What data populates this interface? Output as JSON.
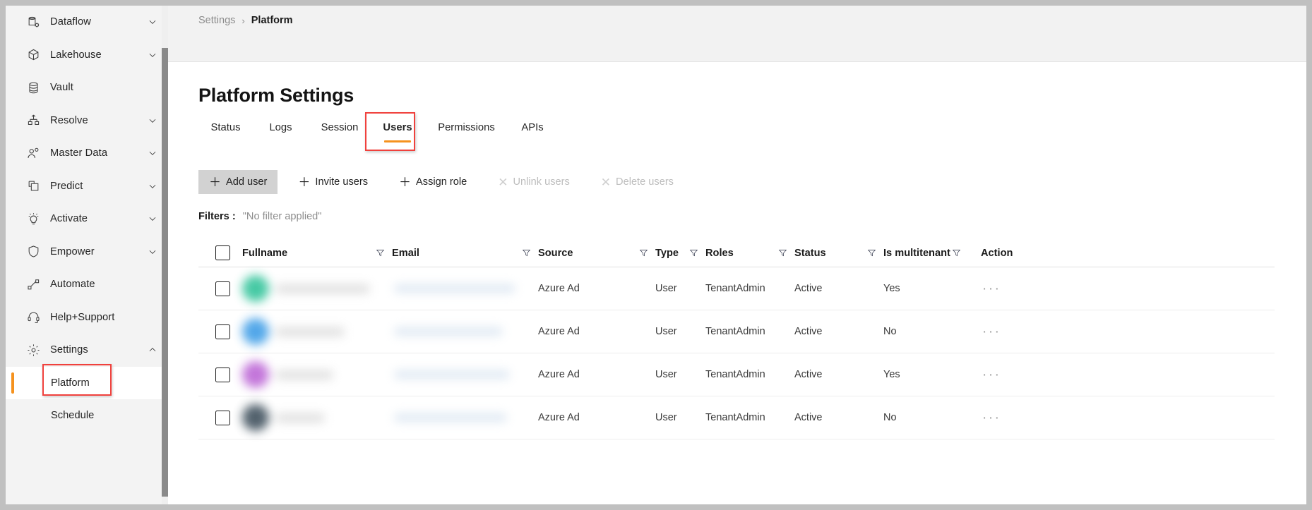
{
  "sidebar": {
    "items": [
      {
        "label": "Dataflow",
        "icon": "database-gear-icon",
        "expandable": true,
        "chevron": "down"
      },
      {
        "label": "Lakehouse",
        "icon": "cube-icon",
        "expandable": true,
        "chevron": "down"
      },
      {
        "label": "Vault",
        "icon": "database-stack-icon",
        "expandable": false,
        "chevron": ""
      },
      {
        "label": "Resolve",
        "icon": "hierarchy-up-icon",
        "expandable": true,
        "chevron": "down"
      },
      {
        "label": "Master Data",
        "icon": "person-add-icon",
        "expandable": true,
        "chevron": "down"
      },
      {
        "label": "Predict",
        "icon": "copy-squares-icon",
        "expandable": true,
        "chevron": "down"
      },
      {
        "label": "Activate",
        "icon": "lightbulb-icon",
        "expandable": true,
        "chevron": "down"
      },
      {
        "label": "Empower",
        "icon": "shield-icon",
        "expandable": true,
        "chevron": "down"
      },
      {
        "label": "Automate",
        "icon": "flow-nodes-icon",
        "expandable": false,
        "chevron": ""
      },
      {
        "label": "Help+Support",
        "icon": "headset-icon",
        "expandable": false,
        "chevron": ""
      },
      {
        "label": "Settings",
        "icon": "gear-icon",
        "expandable": true,
        "chevron": "up"
      }
    ],
    "sub_items": [
      {
        "label": "Platform",
        "active": true,
        "highlighted": true
      },
      {
        "label": "Schedule",
        "active": false,
        "highlighted": false
      }
    ],
    "accent_color": "#f5921e",
    "highlight_color": "#f0413d"
  },
  "breadcrumb": {
    "parent": "Settings",
    "separator": "›",
    "current": "Platform"
  },
  "page": {
    "title": "Platform Settings"
  },
  "tabs": [
    {
      "label": "Status",
      "active": false,
      "highlighted": false
    },
    {
      "label": "Logs",
      "active": false,
      "highlighted": false
    },
    {
      "label": "Session",
      "active": false,
      "highlighted": false
    },
    {
      "label": "Users",
      "active": true,
      "highlighted": true
    },
    {
      "label": "Permissions",
      "active": false,
      "highlighted": false
    },
    {
      "label": "APIs",
      "active": false,
      "highlighted": false
    }
  ],
  "toolbar": [
    {
      "label": "Add user",
      "icon": "plus-icon",
      "glyph": "＋",
      "style": "filled",
      "disabled": false
    },
    {
      "label": "Invite users",
      "icon": "plus-icon",
      "glyph": "＋",
      "style": "plain",
      "disabled": false
    },
    {
      "label": "Assign role",
      "icon": "plus-icon",
      "glyph": "＋",
      "style": "plain",
      "disabled": false
    },
    {
      "label": "Unlink users",
      "icon": "close-icon",
      "glyph": "✕",
      "style": "disabled",
      "disabled": true
    },
    {
      "label": "Delete users",
      "icon": "close-icon",
      "glyph": "✕",
      "style": "disabled",
      "disabled": true
    }
  ],
  "filters": {
    "label": "Filters :",
    "value": "\"No filter applied\""
  },
  "table": {
    "columns": [
      {
        "key": "check",
        "label": "",
        "filter": false
      },
      {
        "key": "full",
        "label": "Fullname",
        "filter": true
      },
      {
        "key": "email",
        "label": "Email",
        "filter": true
      },
      {
        "key": "src",
        "label": "Source",
        "filter": true
      },
      {
        "key": "type",
        "label": "Type",
        "filter": true
      },
      {
        "key": "roles",
        "label": "Roles",
        "filter": true
      },
      {
        "key": "status",
        "label": "Status",
        "filter": true
      },
      {
        "key": "multi",
        "label": "Is multitenant",
        "filter": true
      },
      {
        "key": "action",
        "label": "Action",
        "filter": false
      }
    ],
    "rows": [
      {
        "fullname": "",
        "email": "",
        "source": "Azure Ad",
        "type": "User",
        "roles": "TenantAdmin",
        "status": "Active",
        "is_multitenant": "Yes",
        "action": "···",
        "redacted": true,
        "avatar_color": "#3ec7a0",
        "name_width": 132,
        "email_width": 170
      },
      {
        "fullname": "",
        "email": "",
        "source": "Azure Ad",
        "type": "User",
        "roles": "TenantAdmin",
        "status": "Active",
        "is_multitenant": "No",
        "action": "···",
        "redacted": true,
        "avatar_color": "#4aa3e8",
        "name_width": 96,
        "email_width": 152
      },
      {
        "fullname": "",
        "email": "",
        "source": "Azure Ad",
        "type": "User",
        "roles": "TenantAdmin",
        "status": "Active",
        "is_multitenant": "Yes",
        "action": "···",
        "redacted": true,
        "avatar_color": "#c06fd8",
        "name_width": 80,
        "email_width": 162
      },
      {
        "fullname": "",
        "email": "",
        "source": "Azure Ad",
        "type": "User",
        "roles": "TenantAdmin",
        "status": "Active",
        "is_multitenant": "No",
        "action": "···",
        "redacted": true,
        "avatar_color": "#4a5a66",
        "name_width": 68,
        "email_width": 158
      }
    ]
  }
}
